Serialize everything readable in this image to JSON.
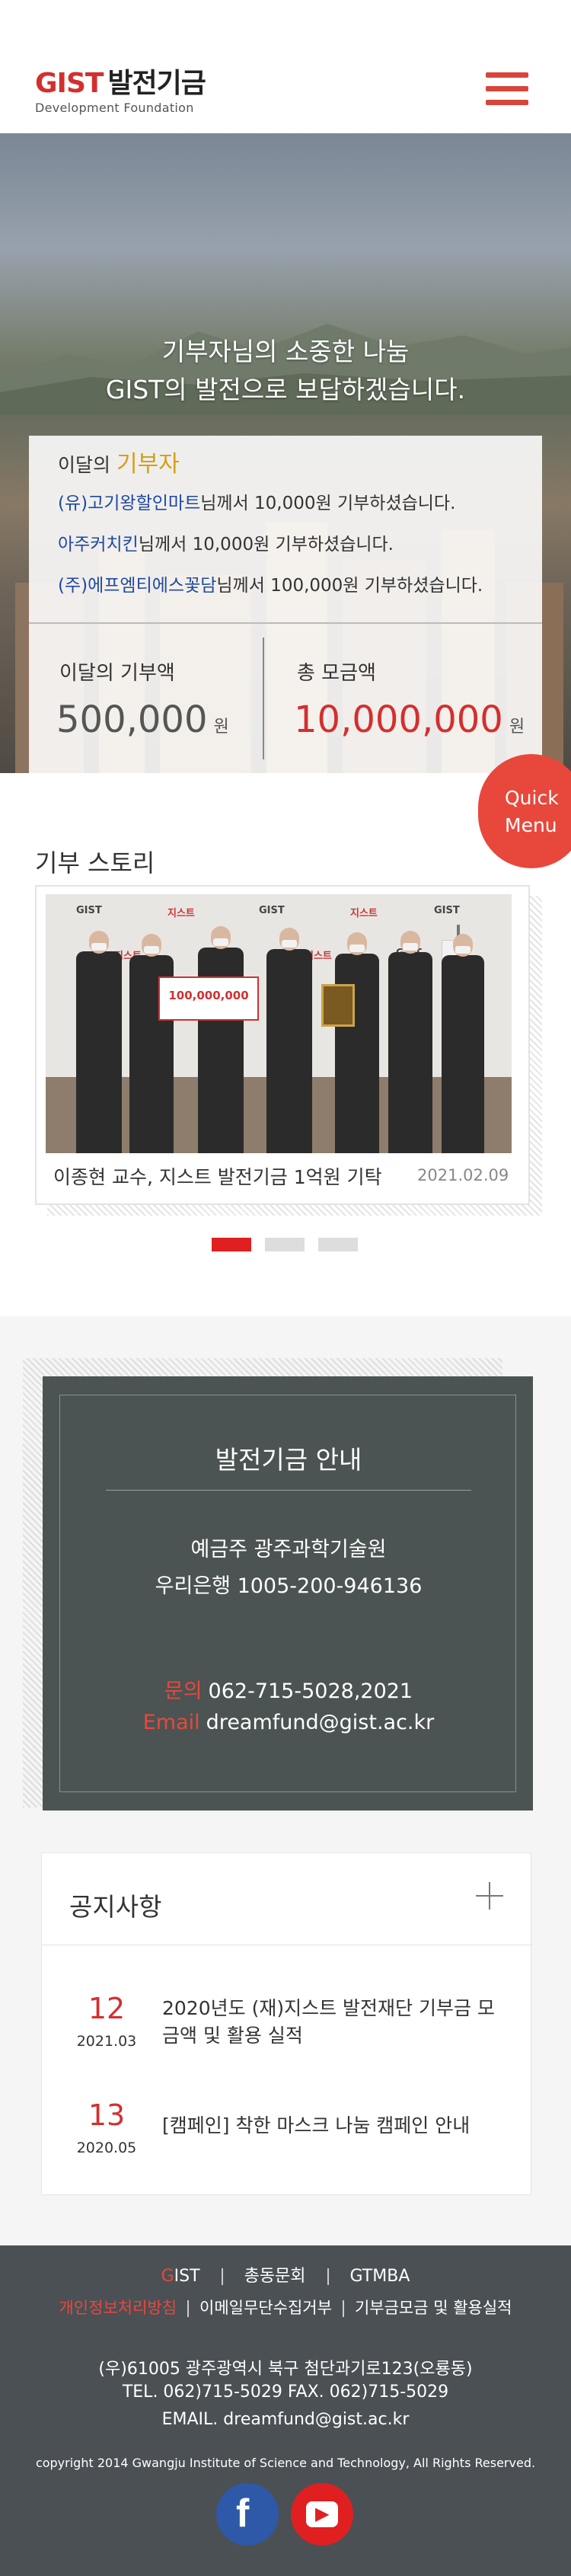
{
  "header": {
    "logo_gist": "GIST",
    "logo_title": "발전기금",
    "logo_sub": "Development Foundation"
  },
  "hero": {
    "title_line1": "기부자님의 소중한 나눔",
    "title_line2": "GIST의 발전으로 보답하겠습니다.",
    "donors_prefix": "이달의",
    "donors_em": "기부자",
    "donors": [
      {
        "name": "(유)고기왕할인마트",
        "text": "님께서 10,000원 기부하셨습니다."
      },
      {
        "name": "아주커치킨",
        "text": "님께서 10,000원 기부하셨습니다."
      },
      {
        "name": "(주)에프엠티에스꽃담",
        "text": "님께서 100,000원 기부하셨습니다."
      }
    ],
    "month_label": "이달의 기부액",
    "month_value": "500,000",
    "total_label": "총 모금액",
    "total_value": "10,000,000",
    "unit": "원",
    "accent_color": "#d32f2f"
  },
  "quick_menu": {
    "line1": "Quick",
    "line2": "Menu"
  },
  "story": {
    "title": "기부 스토리",
    "sign_amount": "100,000,000",
    "caption": "이종현 교수, 지스트 발전기금 1억원 기탁",
    "date": "2021.02.09",
    "slides_count": 3,
    "active_slide": 1
  },
  "fund": {
    "title": "발전기금 안내",
    "holder": "예금주 광주과학기술원",
    "bank": "우리은행  1005-200-946136",
    "phone_label": "문의",
    "phone": "062-715-5028,2021",
    "email_label": "Email",
    "email": "dreamfund@gist.ac.kr"
  },
  "notice": {
    "title": "공지사항",
    "items": [
      {
        "day": "12",
        "ym": "2021.03",
        "text": "2020년도 (재)지스트 발전재단  기부금 모금액 및 활용 실적"
      },
      {
        "day": "13",
        "ym": "2020.05",
        "text": "[캠페인] 착한 마스크 나눔 캠페인 안내"
      }
    ]
  },
  "footer": {
    "links1": [
      "GIST",
      "총동문회",
      "GTMBA"
    ],
    "links2": [
      "개인정보처리방침",
      "이메일무단수집거부",
      "기부금모금 및 활용실적"
    ],
    "address": "(우)61005 광주광역시 북구 첨단과기로123(오룡동)",
    "telfax": "TEL. 062)715-5029    FAX. 062)715-5029",
    "email": "EMAIL. dreamfund@gist.ac.kr",
    "copyright": "copyright 2014 Gwangju Institute of Science and Technology, All Rights Reserved.",
    "facebook_icon": "f",
    "youtube_icon": "▶"
  }
}
